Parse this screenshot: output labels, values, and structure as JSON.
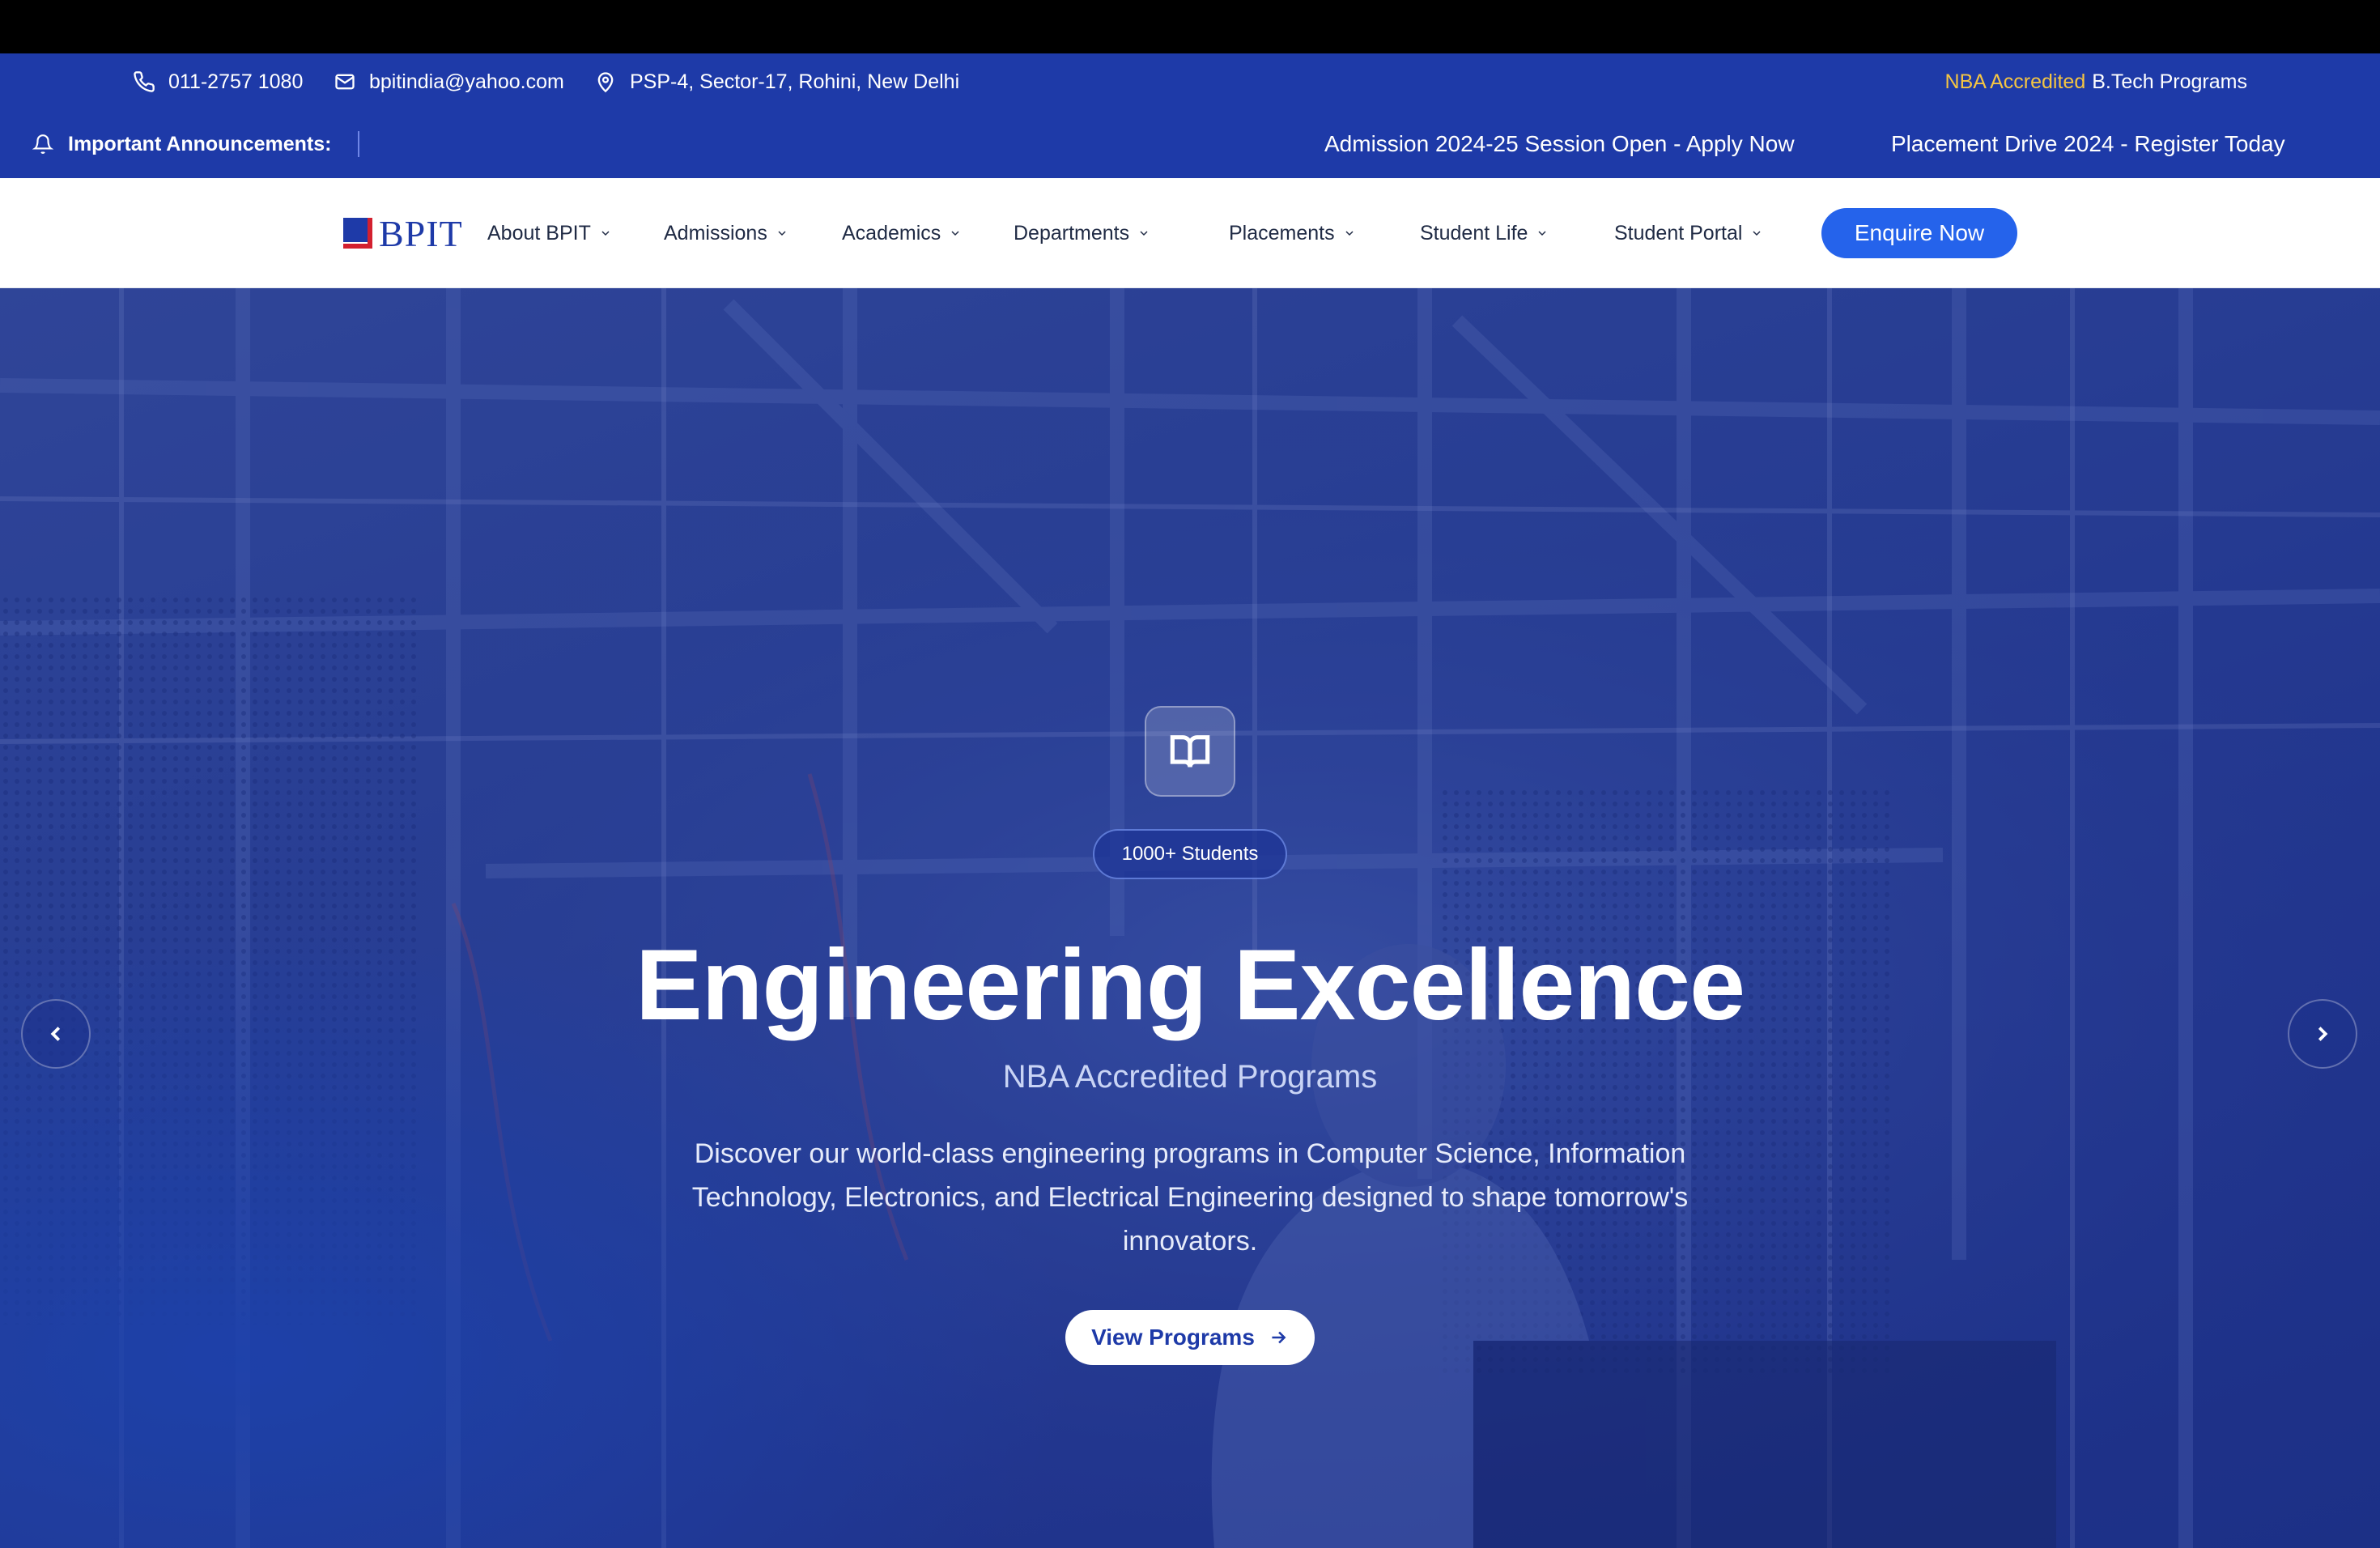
{
  "topbar": {
    "phone": "011-2757 1080",
    "email": "bpitindia@yahoo.com",
    "address": "PSP-4, Sector-17, Rohini, New Delhi",
    "accredited_highlight": "NBA Accredited",
    "accredited_rest": "B.Tech Programs",
    "highlight_color": "#f5c542",
    "background_color": "#1e3aa8"
  },
  "announcements": {
    "label": "Important Announcements:",
    "items": [
      "Admission 2024-25 Session Open - Apply Now",
      "Placement Drive 2024 - Register Today"
    ]
  },
  "nav": {
    "logo_text": "BPIT",
    "items": [
      "About BPIT",
      "Admissions",
      "Academics",
      "Departments",
      "Placements",
      "Student Life",
      "Student Portal"
    ],
    "cta_label": "Enquire Now",
    "cta_color": "#2563eb"
  },
  "hero": {
    "badge_icon": "book-open-icon",
    "pill": "1000+ Students",
    "title": "Engineering Excellence",
    "subtitle": "NBA Accredited Programs",
    "description": "Discover our world-class engineering programs in Computer Science, Information Technology, Electronics, and Electrical Engineering designed to shape tomorrow's innovators.",
    "button_label": "View Programs",
    "prev_icon": "chevron-left-icon",
    "next_icon": "chevron-right-icon"
  }
}
